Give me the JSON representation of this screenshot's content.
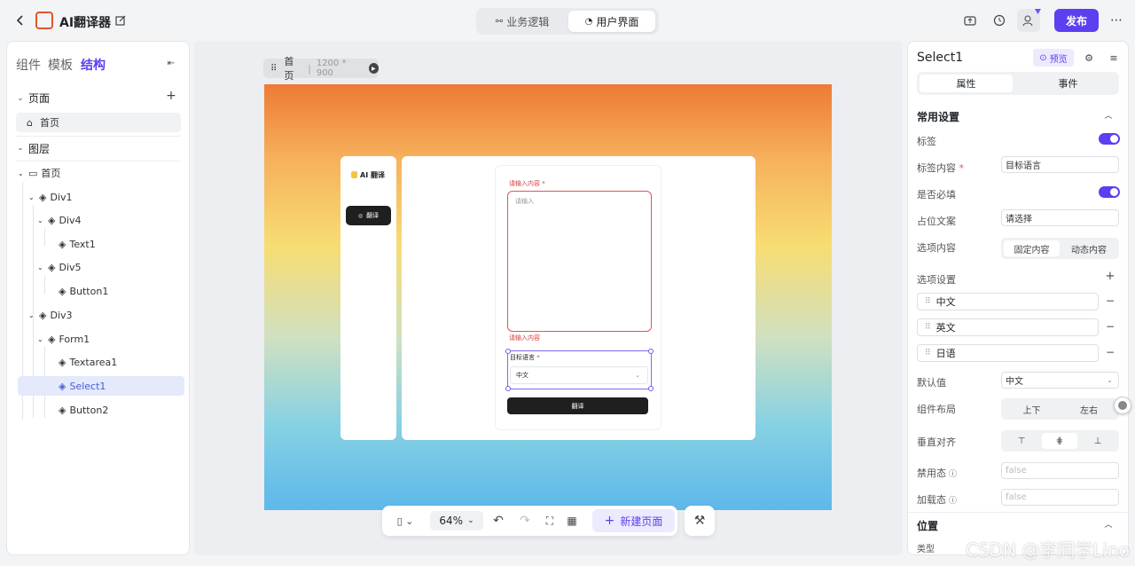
{
  "app": {
    "title": "AI翻译器",
    "publish": "发布"
  },
  "top_tabs": [
    {
      "label": "业务逻辑"
    },
    {
      "label": "用户界面"
    }
  ],
  "left": {
    "tabs": [
      "组件",
      "模板",
      "结构"
    ],
    "pages_title": "页面",
    "page_item": "首页",
    "layers_title": "图层",
    "tree": [
      "首页",
      "Div1",
      "Div4",
      "Text1",
      "Div5",
      "Button1",
      "Div3",
      "Form1",
      "Textarea1",
      "Select1",
      "Button2"
    ]
  },
  "canvas": {
    "crumb_page": "首页",
    "crumb_size": "1200 * 900"
  },
  "preview": {
    "logo": "AI 翻译",
    "nav_button": "翻译",
    "input_label": "请输入内容",
    "input_placeholder": "请输入",
    "input_error": "请输入内容",
    "select_label": "目标语言",
    "select_value": "中文",
    "submit": "翻译"
  },
  "bottom_toolbar": {
    "zoom": "64%",
    "new_page": "新建页面"
  },
  "right": {
    "title": "Select1",
    "preview": "预览",
    "tabs": [
      "属性",
      "事件"
    ],
    "section": "常用设置",
    "label": "标签",
    "label_content": "标签内容",
    "label_content_value": "目标语言",
    "required": "是否必填",
    "placeholder": "占位文案",
    "placeholder_value": "请选择",
    "options_content": "选项内容",
    "options_modes": [
      "固定内容",
      "动态内容"
    ],
    "options_setting": "选项设置",
    "options": [
      "中文",
      "英文",
      "日语"
    ],
    "default": "默认值",
    "default_value": "中文",
    "layout": "组件布局",
    "layout_modes": [
      "上下",
      "左右"
    ],
    "valign": "垂直对齐",
    "disabled": "禁用态",
    "disabled_value": "false",
    "loading": "加载态",
    "loading_value": "false",
    "position": "位置",
    "type_label": "类型"
  },
  "watermark": "CSDN @李同学Lino"
}
